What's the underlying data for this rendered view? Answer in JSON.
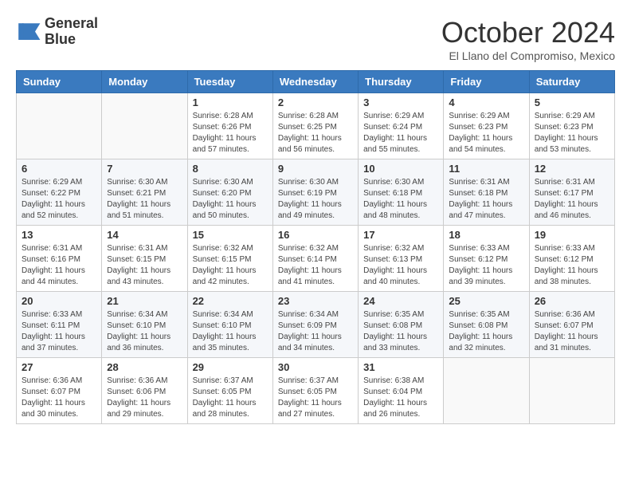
{
  "header": {
    "logo_line1": "General",
    "logo_line2": "Blue",
    "month": "October 2024",
    "location": "El Llano del Compromiso, Mexico"
  },
  "weekdays": [
    "Sunday",
    "Monday",
    "Tuesday",
    "Wednesday",
    "Thursday",
    "Friday",
    "Saturday"
  ],
  "weeks": [
    [
      {
        "day": "",
        "info": ""
      },
      {
        "day": "",
        "info": ""
      },
      {
        "day": "1",
        "info": "Sunrise: 6:28 AM\nSunset: 6:26 PM\nDaylight: 11 hours and 57 minutes."
      },
      {
        "day": "2",
        "info": "Sunrise: 6:28 AM\nSunset: 6:25 PM\nDaylight: 11 hours and 56 minutes."
      },
      {
        "day": "3",
        "info": "Sunrise: 6:29 AM\nSunset: 6:24 PM\nDaylight: 11 hours and 55 minutes."
      },
      {
        "day": "4",
        "info": "Sunrise: 6:29 AM\nSunset: 6:23 PM\nDaylight: 11 hours and 54 minutes."
      },
      {
        "day": "5",
        "info": "Sunrise: 6:29 AM\nSunset: 6:23 PM\nDaylight: 11 hours and 53 minutes."
      }
    ],
    [
      {
        "day": "6",
        "info": "Sunrise: 6:29 AM\nSunset: 6:22 PM\nDaylight: 11 hours and 52 minutes."
      },
      {
        "day": "7",
        "info": "Sunrise: 6:30 AM\nSunset: 6:21 PM\nDaylight: 11 hours and 51 minutes."
      },
      {
        "day": "8",
        "info": "Sunrise: 6:30 AM\nSunset: 6:20 PM\nDaylight: 11 hours and 50 minutes."
      },
      {
        "day": "9",
        "info": "Sunrise: 6:30 AM\nSunset: 6:19 PM\nDaylight: 11 hours and 49 minutes."
      },
      {
        "day": "10",
        "info": "Sunrise: 6:30 AM\nSunset: 6:18 PM\nDaylight: 11 hours and 48 minutes."
      },
      {
        "day": "11",
        "info": "Sunrise: 6:31 AM\nSunset: 6:18 PM\nDaylight: 11 hours and 47 minutes."
      },
      {
        "day": "12",
        "info": "Sunrise: 6:31 AM\nSunset: 6:17 PM\nDaylight: 11 hours and 46 minutes."
      }
    ],
    [
      {
        "day": "13",
        "info": "Sunrise: 6:31 AM\nSunset: 6:16 PM\nDaylight: 11 hours and 44 minutes."
      },
      {
        "day": "14",
        "info": "Sunrise: 6:31 AM\nSunset: 6:15 PM\nDaylight: 11 hours and 43 minutes."
      },
      {
        "day": "15",
        "info": "Sunrise: 6:32 AM\nSunset: 6:15 PM\nDaylight: 11 hours and 42 minutes."
      },
      {
        "day": "16",
        "info": "Sunrise: 6:32 AM\nSunset: 6:14 PM\nDaylight: 11 hours and 41 minutes."
      },
      {
        "day": "17",
        "info": "Sunrise: 6:32 AM\nSunset: 6:13 PM\nDaylight: 11 hours and 40 minutes."
      },
      {
        "day": "18",
        "info": "Sunrise: 6:33 AM\nSunset: 6:12 PM\nDaylight: 11 hours and 39 minutes."
      },
      {
        "day": "19",
        "info": "Sunrise: 6:33 AM\nSunset: 6:12 PM\nDaylight: 11 hours and 38 minutes."
      }
    ],
    [
      {
        "day": "20",
        "info": "Sunrise: 6:33 AM\nSunset: 6:11 PM\nDaylight: 11 hours and 37 minutes."
      },
      {
        "day": "21",
        "info": "Sunrise: 6:34 AM\nSunset: 6:10 PM\nDaylight: 11 hours and 36 minutes."
      },
      {
        "day": "22",
        "info": "Sunrise: 6:34 AM\nSunset: 6:10 PM\nDaylight: 11 hours and 35 minutes."
      },
      {
        "day": "23",
        "info": "Sunrise: 6:34 AM\nSunset: 6:09 PM\nDaylight: 11 hours and 34 minutes."
      },
      {
        "day": "24",
        "info": "Sunrise: 6:35 AM\nSunset: 6:08 PM\nDaylight: 11 hours and 33 minutes."
      },
      {
        "day": "25",
        "info": "Sunrise: 6:35 AM\nSunset: 6:08 PM\nDaylight: 11 hours and 32 minutes."
      },
      {
        "day": "26",
        "info": "Sunrise: 6:36 AM\nSunset: 6:07 PM\nDaylight: 11 hours and 31 minutes."
      }
    ],
    [
      {
        "day": "27",
        "info": "Sunrise: 6:36 AM\nSunset: 6:07 PM\nDaylight: 11 hours and 30 minutes."
      },
      {
        "day": "28",
        "info": "Sunrise: 6:36 AM\nSunset: 6:06 PM\nDaylight: 11 hours and 29 minutes."
      },
      {
        "day": "29",
        "info": "Sunrise: 6:37 AM\nSunset: 6:05 PM\nDaylight: 11 hours and 28 minutes."
      },
      {
        "day": "30",
        "info": "Sunrise: 6:37 AM\nSunset: 6:05 PM\nDaylight: 11 hours and 27 minutes."
      },
      {
        "day": "31",
        "info": "Sunrise: 6:38 AM\nSunset: 6:04 PM\nDaylight: 11 hours and 26 minutes."
      },
      {
        "day": "",
        "info": ""
      },
      {
        "day": "",
        "info": ""
      }
    ]
  ]
}
